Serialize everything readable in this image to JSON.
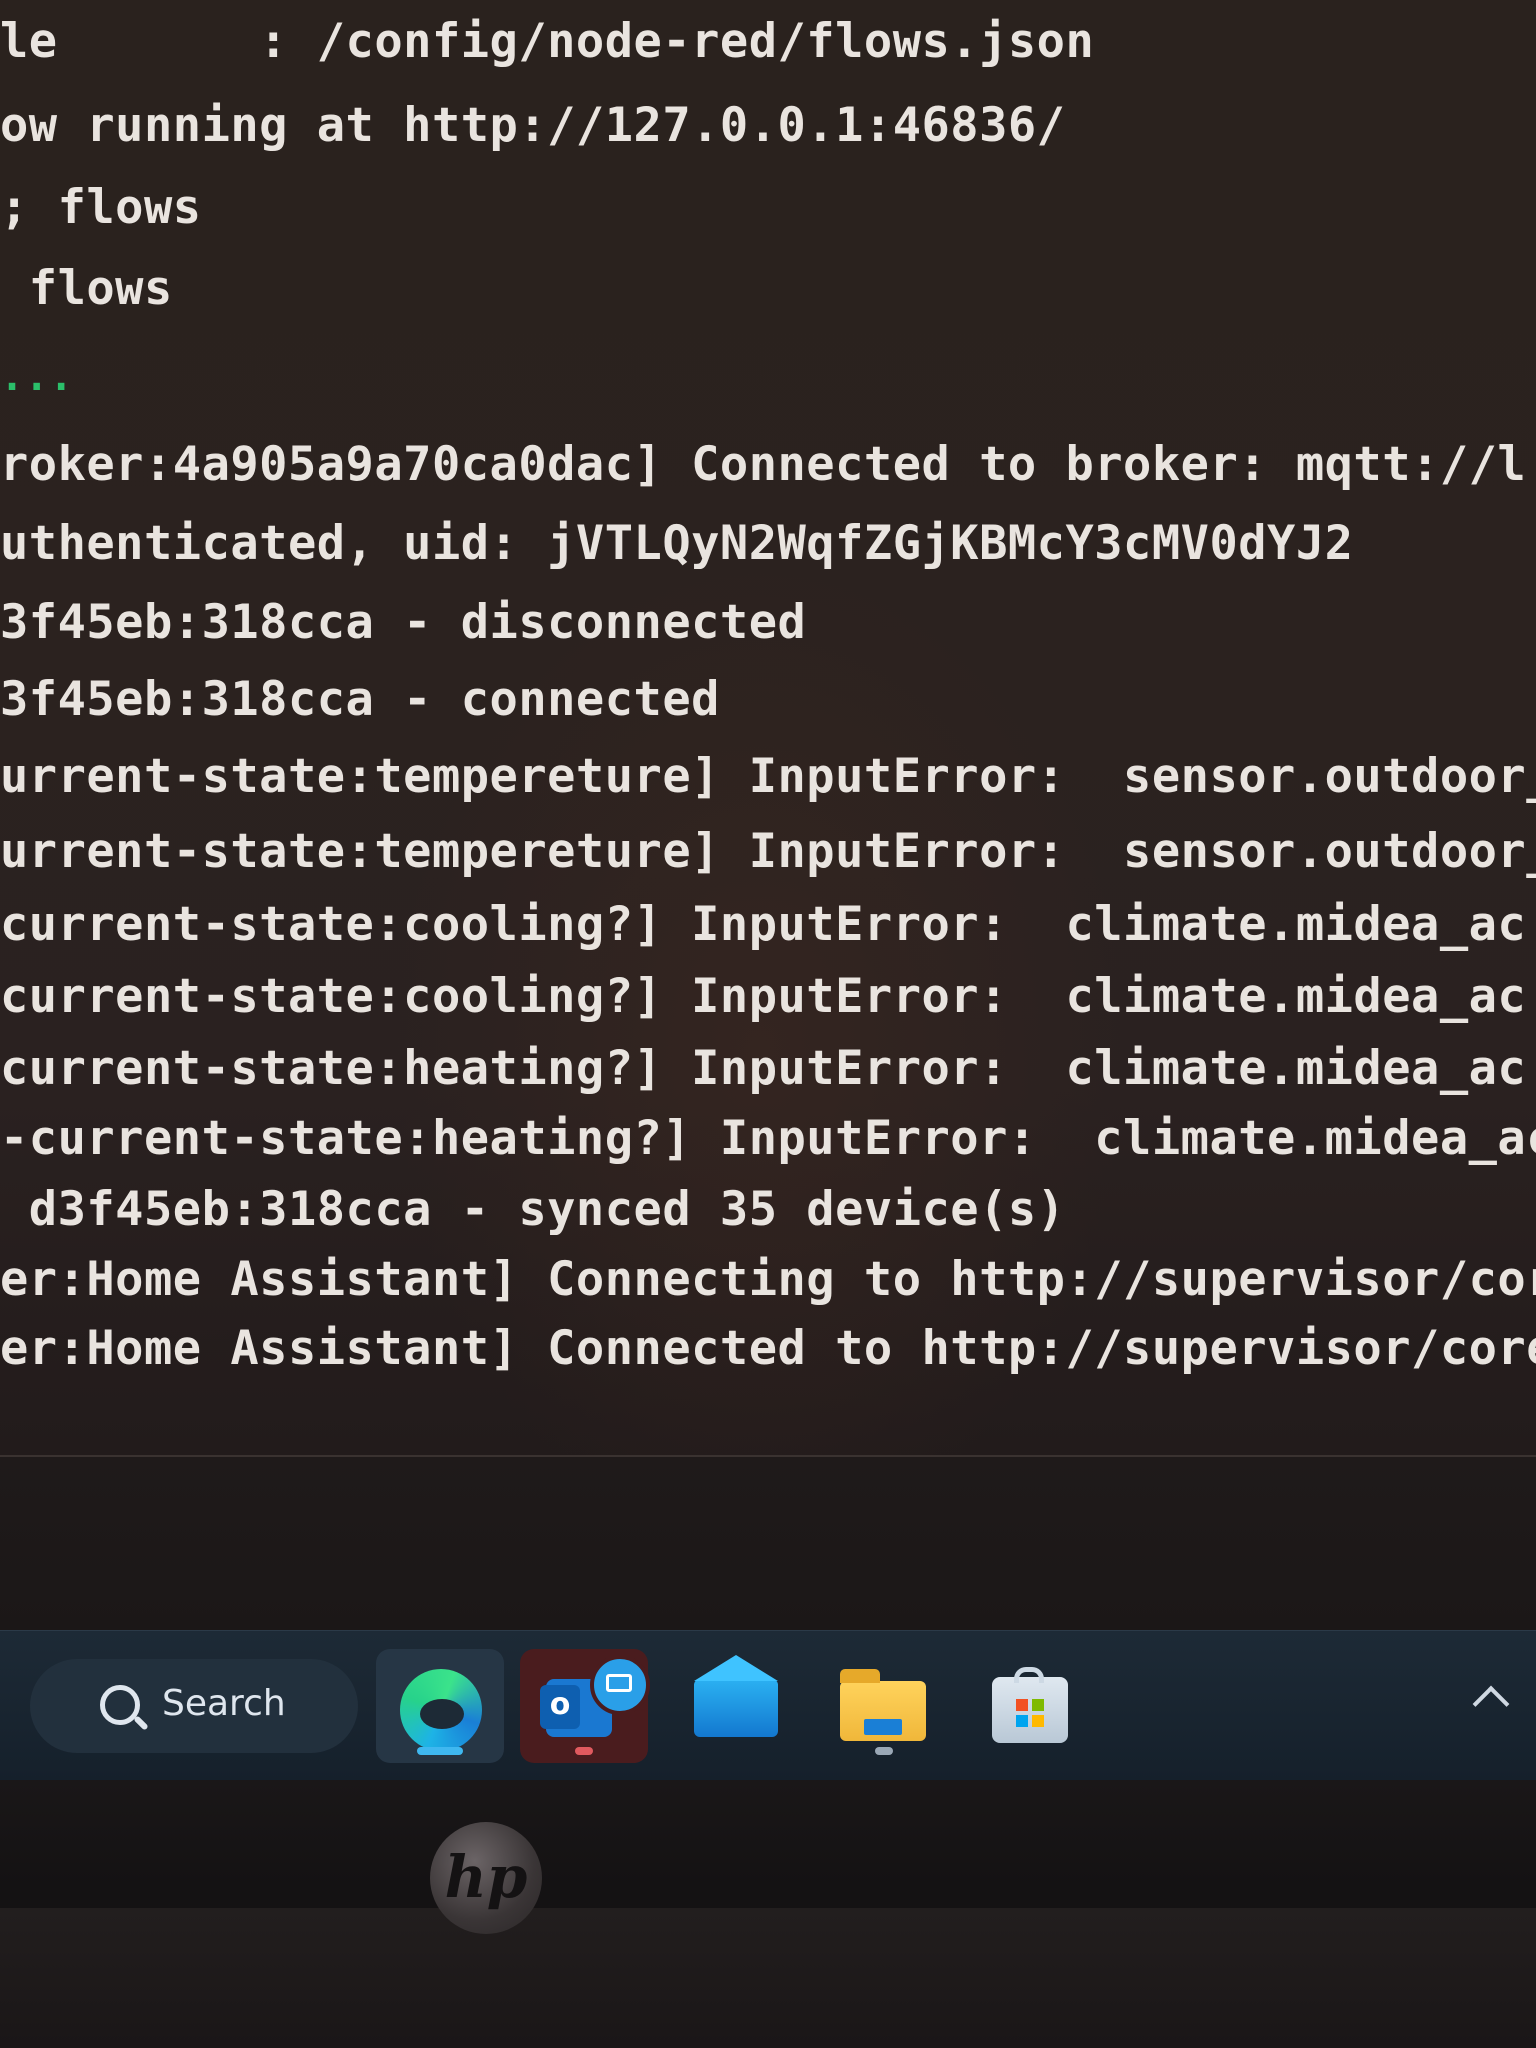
{
  "terminal": {
    "lines": [
      {
        "text": "le       : /config/node-red/flows.json"
      },
      {
        "text": "ow running at http://127.0.0.1:46836/"
      },
      {
        "text": "; flows"
      },
      {
        "text": " flows"
      },
      {
        "text": "...",
        "kind": "dots"
      },
      {
        "text": "roker:4a905a9a70ca0dac] Connected to broker: mqtt://l"
      },
      {
        "text": "uthenticated, uid: jVTLQyN2WqfZGjKBMcY3cMV0dYJ2"
      },
      {
        "text": "3f45eb:318cca - disconnected"
      },
      {
        "text": "3f45eb:318cca - connected"
      },
      {
        "text": "urrent-state:tempereture] InputError:  sensor.outdoor_"
      },
      {
        "text": "urrent-state:tempereture] InputError:  sensor.outdoor_"
      },
      {
        "text": "current-state:cooling?] InputError:  climate.midea_ac"
      },
      {
        "text": "current-state:cooling?] InputError:  climate.midea_ac"
      },
      {
        "text": "current-state:heating?] InputError:  climate.midea_ac"
      },
      {
        "text": "-current-state:heating?] InputError:  climate.midea_ac"
      },
      {
        "text": " d3f45eb:318cca - synced 35 device(s)"
      },
      {
        "text": "er:Home Assistant] Connecting to http://supervisor/core"
      },
      {
        "text": "er:Home Assistant] Connected to http://supervisor/core"
      }
    ]
  },
  "taskbar": {
    "search_label": "Search",
    "apps": [
      {
        "name": "edge",
        "icon": "edge-icon"
      },
      {
        "name": "outlook",
        "icon": "outlook-icon"
      },
      {
        "name": "mail",
        "icon": "mail-icon"
      },
      {
        "name": "file-explorer",
        "icon": "folder-icon"
      },
      {
        "name": "microsoft-store",
        "icon": "store-icon"
      }
    ],
    "overflow_icon": "chevron-up-icon"
  },
  "bezel": {
    "logo": "hp"
  },
  "colors": {
    "terminal_bg": "#2a221e",
    "terminal_text": "#e9e4df",
    "dots": "#2bbf6a",
    "taskbar_bg": "#1d2a36",
    "edge_indicator": "#3fb8f0",
    "outlook_indicator": "#e05a5f",
    "explorer_indicator": "#9aa8b6"
  }
}
